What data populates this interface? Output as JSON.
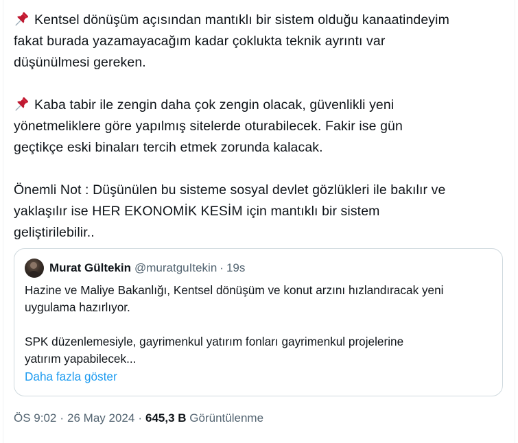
{
  "tweet": {
    "paragraphs": [
      {
        "pin": true,
        "lines": [
          "Kentsel dönüşüm açısından mantıklı bir sistem olduğu kanaatindeyim",
          "fakat burada yazamayacağım kadar çoklukta teknik ayrıntı var",
          "düşünülmesi gereken."
        ]
      },
      {
        "pin": true,
        "lines": [
          "Kaba tabir ile zengin daha çok zengin olacak, güvenlikli yeni",
          "yönetmeliklere göre yapılmış sitelerde oturabilecek. Fakir ise gün",
          "geçtikçe eski binaları tercih etmek zorunda kalacak."
        ]
      },
      {
        "pin": false,
        "lines": [
          "Önemli Not : Düşünülen bu sisteme sosyal devlet gözlükleri ile bakılır ve",
          "yaklaşılır ise HER EKONOMİK KESİM için mantıklı bir sistem",
          "geliştirilebilir.."
        ]
      }
    ],
    "pin_icon": "pushpin-icon"
  },
  "quote": {
    "name": "Murat Gültekin",
    "handle": "@muratguItekin",
    "separator": "·",
    "time": "19s",
    "paragraphs": [
      [
        "Hazine ve Maliye Bakanlığı, Kentsel dönüşüm ve konut arzını hızlandıracak yeni",
        "uygulama hazırlıyor."
      ],
      [
        "SPK düzenlemesiyle, gayrimenkul yatırım fonları gayrimenkul projelerine",
        "yatırım yapabilecek..."
      ]
    ],
    "show_more": "Daha fazla göster"
  },
  "meta": {
    "time": "ÖS 9:02",
    "sep1": "·",
    "date": "26 May 2024",
    "sep2": "·",
    "views_count": "645,3 B",
    "views_label": "Görüntülenme"
  },
  "colors": {
    "text": "#0f1419",
    "secondary": "#536471",
    "link": "#1d9bf0",
    "border": "#cfd9de",
    "pin": "#e0245e"
  }
}
